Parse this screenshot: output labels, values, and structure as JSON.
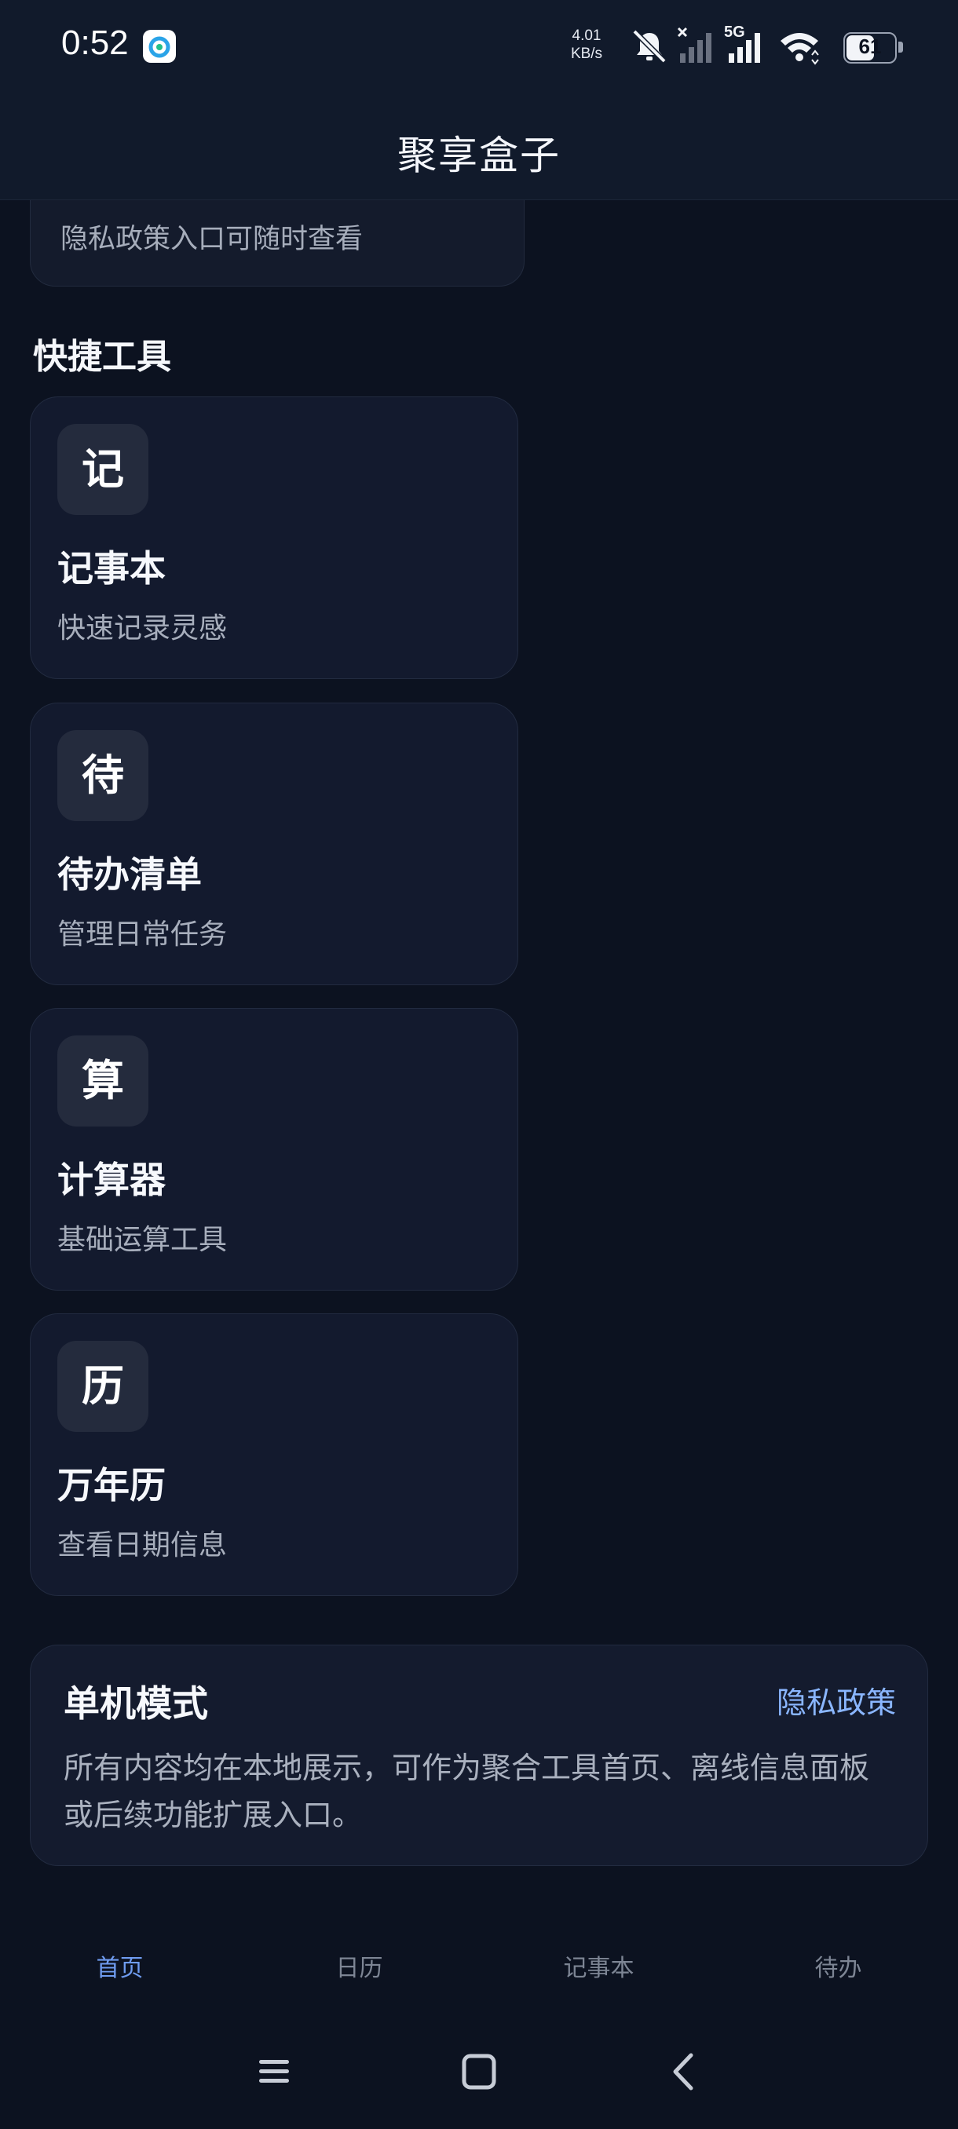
{
  "status_bar": {
    "time": "0:52",
    "net_speed_value": "4.01",
    "net_speed_unit": "KB/s",
    "network_type": "5G",
    "battery_level": "61",
    "battery_fraction": 0.61,
    "icons": [
      "app-notification-icon",
      "mute-icon",
      "no-signal-icon",
      "signal-icon",
      "wifi-icon",
      "battery-icon"
    ]
  },
  "app_bar": {
    "title": "聚享盒子"
  },
  "privacy_notice": {
    "text": "隐私政策入口可随时查看"
  },
  "tools_section": {
    "title": "快捷工具",
    "tools": [
      {
        "icon_char": "记",
        "name": "记事本",
        "desc": "快速记录灵感"
      },
      {
        "icon_char": "待",
        "name": "待办清单",
        "desc": "管理日常任务"
      },
      {
        "icon_char": "算",
        "name": "计算器",
        "desc": "基础运算工具"
      },
      {
        "icon_char": "历",
        "name": "万年历",
        "desc": "查看日期信息"
      }
    ]
  },
  "offline_card": {
    "title": "单机模式",
    "link": "隐私政策",
    "desc": "所有内容均在本地展示，可作为聚合工具首页、离线信息面板或后续功能扩展入口。"
  },
  "bottom_nav": {
    "tabs": [
      {
        "label": "首页",
        "active": true
      },
      {
        "label": "日历",
        "active": false
      },
      {
        "label": "记事本",
        "active": false
      },
      {
        "label": "待办",
        "active": false
      }
    ]
  },
  "system_nav": {
    "buttons": [
      "menu-icon",
      "home-icon",
      "back-icon"
    ]
  },
  "colors": {
    "background": "#0c1220",
    "card": "#131a2e",
    "accent": "#6f9cf0",
    "link": "#8ab6ff"
  }
}
